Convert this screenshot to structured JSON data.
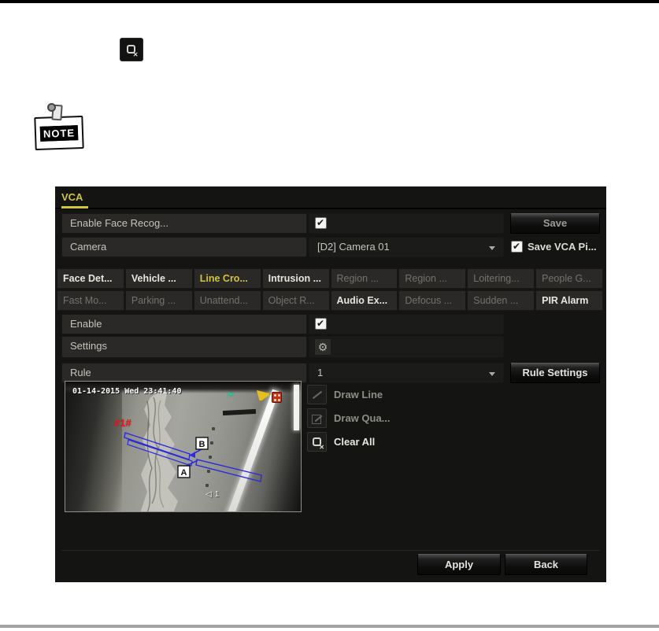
{
  "toolbar": {
    "clear_icon": "clear-all-icon"
  },
  "note": {
    "label": "NOTE"
  },
  "vca": {
    "title": "VCA",
    "form": {
      "enable_face_label": "Enable Face Recog...",
      "enable_face_checked": true,
      "save_button": "Save",
      "camera_label": "Camera",
      "camera_value": "[D2] Camera 01",
      "save_vca_pic_label": "Save VCA Pi...",
      "save_vca_pic_checked": true,
      "enable_label": "Enable",
      "enable_checked": true,
      "settings_label": "Settings",
      "rule_label": "Rule",
      "rule_value": "1",
      "rule_settings_button": "Rule Settings"
    },
    "tabs": {
      "row1": [
        {
          "label": "Face Det...",
          "state": "bright"
        },
        {
          "label": "Vehicle ...",
          "state": "bright"
        },
        {
          "label": "Line Cro...",
          "state": "active"
        },
        {
          "label": "Intrusion ...",
          "state": "bright"
        },
        {
          "label": "Region ...",
          "state": "dim"
        },
        {
          "label": "Region ...",
          "state": "dim"
        },
        {
          "label": "Loitering...",
          "state": "dim"
        },
        {
          "label": "People G...",
          "state": "dim"
        }
      ],
      "row2": [
        {
          "label": "Fast Mo...",
          "state": "dim"
        },
        {
          "label": "Parking ...",
          "state": "dim"
        },
        {
          "label": "Unattend...",
          "state": "dim"
        },
        {
          "label": "Object R...",
          "state": "dim"
        },
        {
          "label": "Audio Ex...",
          "state": "bright"
        },
        {
          "label": "Defocus ...",
          "state": "dim"
        },
        {
          "label": "Sudden ...",
          "state": "dim"
        },
        {
          "label": "PIR Alarm",
          "state": "bright"
        }
      ]
    },
    "video": {
      "timestamp": "01-14-2015 Wed 23:41:40",
      "rule_tag": "#1#",
      "marker_a": "A",
      "marker_b": "B",
      "audio_channel": "1"
    },
    "tools": {
      "draw_line": "Draw Line",
      "draw_quad": "Draw Qua...",
      "clear_all": "Clear All"
    },
    "actions": {
      "apply": "Apply",
      "back": "Back"
    }
  },
  "colors": {
    "accent_yellow": "#d2c53e",
    "rule_line_blue": "#2b2bdc",
    "tag_red": "#e02020",
    "panel_bg": "#141412",
    "page_bg": "#ffffff"
  },
  "icons": {
    "top_toolbar": "clear-all-icon",
    "note_badge": "notepad-pin-icon",
    "settings_row": "gear-icon",
    "camera_select": "chevron-down-icon",
    "rule_select": "chevron-down-icon",
    "draw_line": "draw-line-icon",
    "draw_quad": "draw-quad-icon",
    "clear_all": "clear-all-icon",
    "video_audio": "speaker-icon",
    "video_alarm": "alarm-flag-icon",
    "video_event": "event-dice-icon",
    "video_motion": "green-arrow-icon"
  }
}
